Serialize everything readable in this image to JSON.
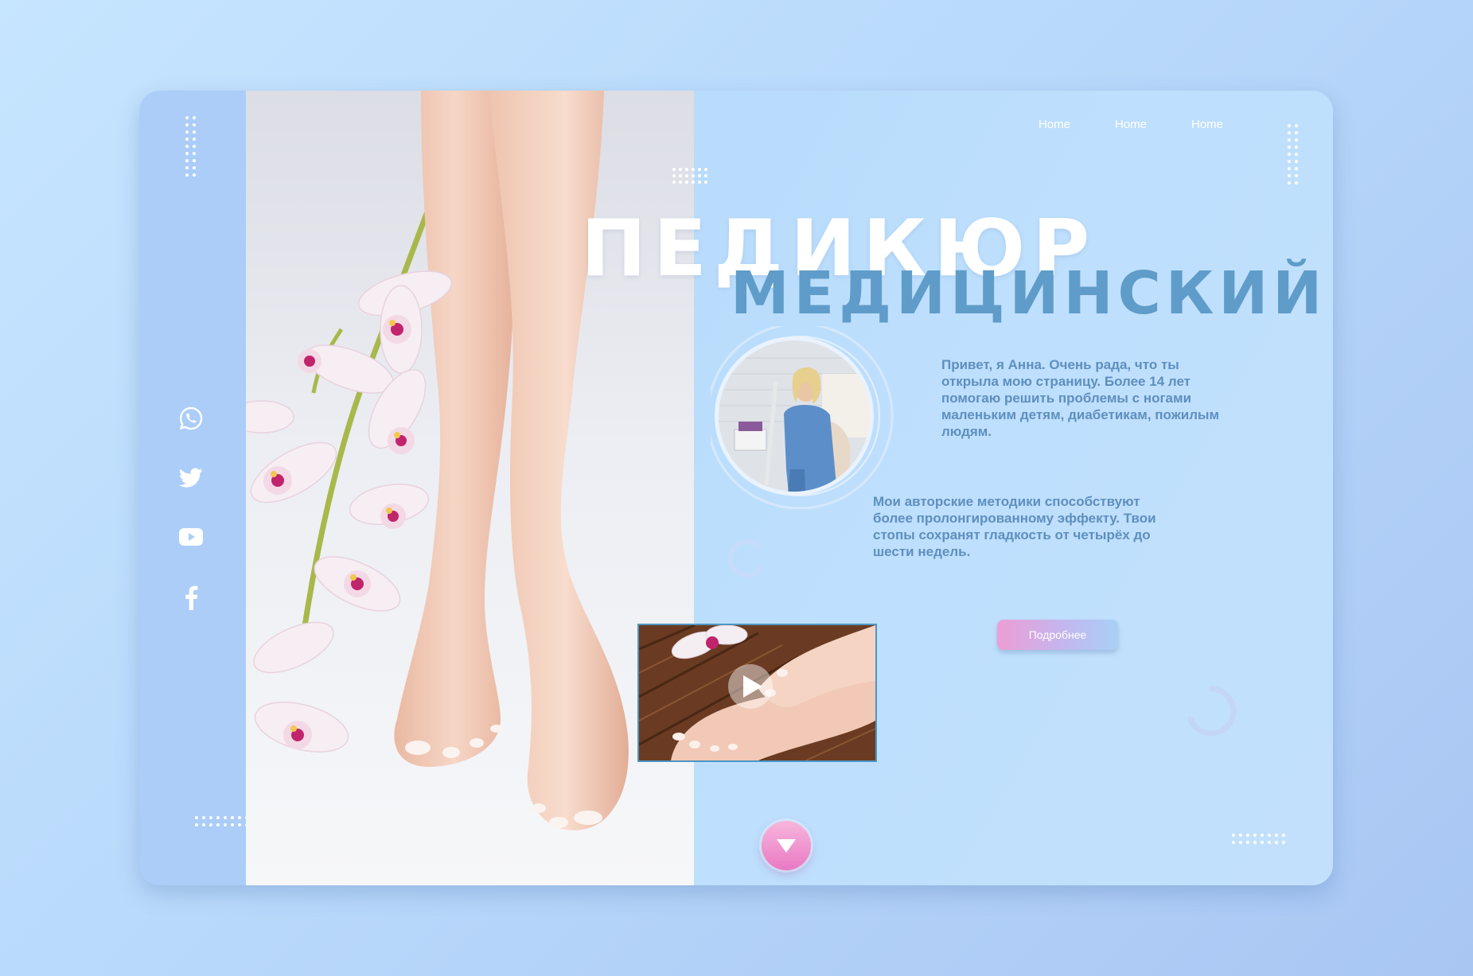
{
  "nav": {
    "items": [
      "Home",
      "Home",
      "Home"
    ]
  },
  "hero": {
    "title_primary": "ПЕДИКЮР",
    "title_secondary": "МЕДИЦИНСКИЙ"
  },
  "intro": {
    "greeting": "Привет, я Анна. Очень рада, что ты открыла мою страницу. Более 14 лет помогаю решить проблемы с ногами маленьким детям, диабетикам, пожилым людям.",
    "methods": "Мои авторские методики способствуют более пролонгированному эффекту. Твои стопы сохранят гладкость от  четырёх до шести недель."
  },
  "cta": {
    "label": "Подробнее"
  },
  "social": [
    "whatsapp-icon",
    "twitter-icon",
    "youtube-icon",
    "facebook-icon"
  ],
  "colors": {
    "background": "#bcdcfd",
    "card": "#b8d9fc",
    "sidebar": "#abcdf8",
    "title_secondary": "#5f9cc9",
    "body_text": "#5e8fbf",
    "accent_pink": "#e979c4"
  }
}
